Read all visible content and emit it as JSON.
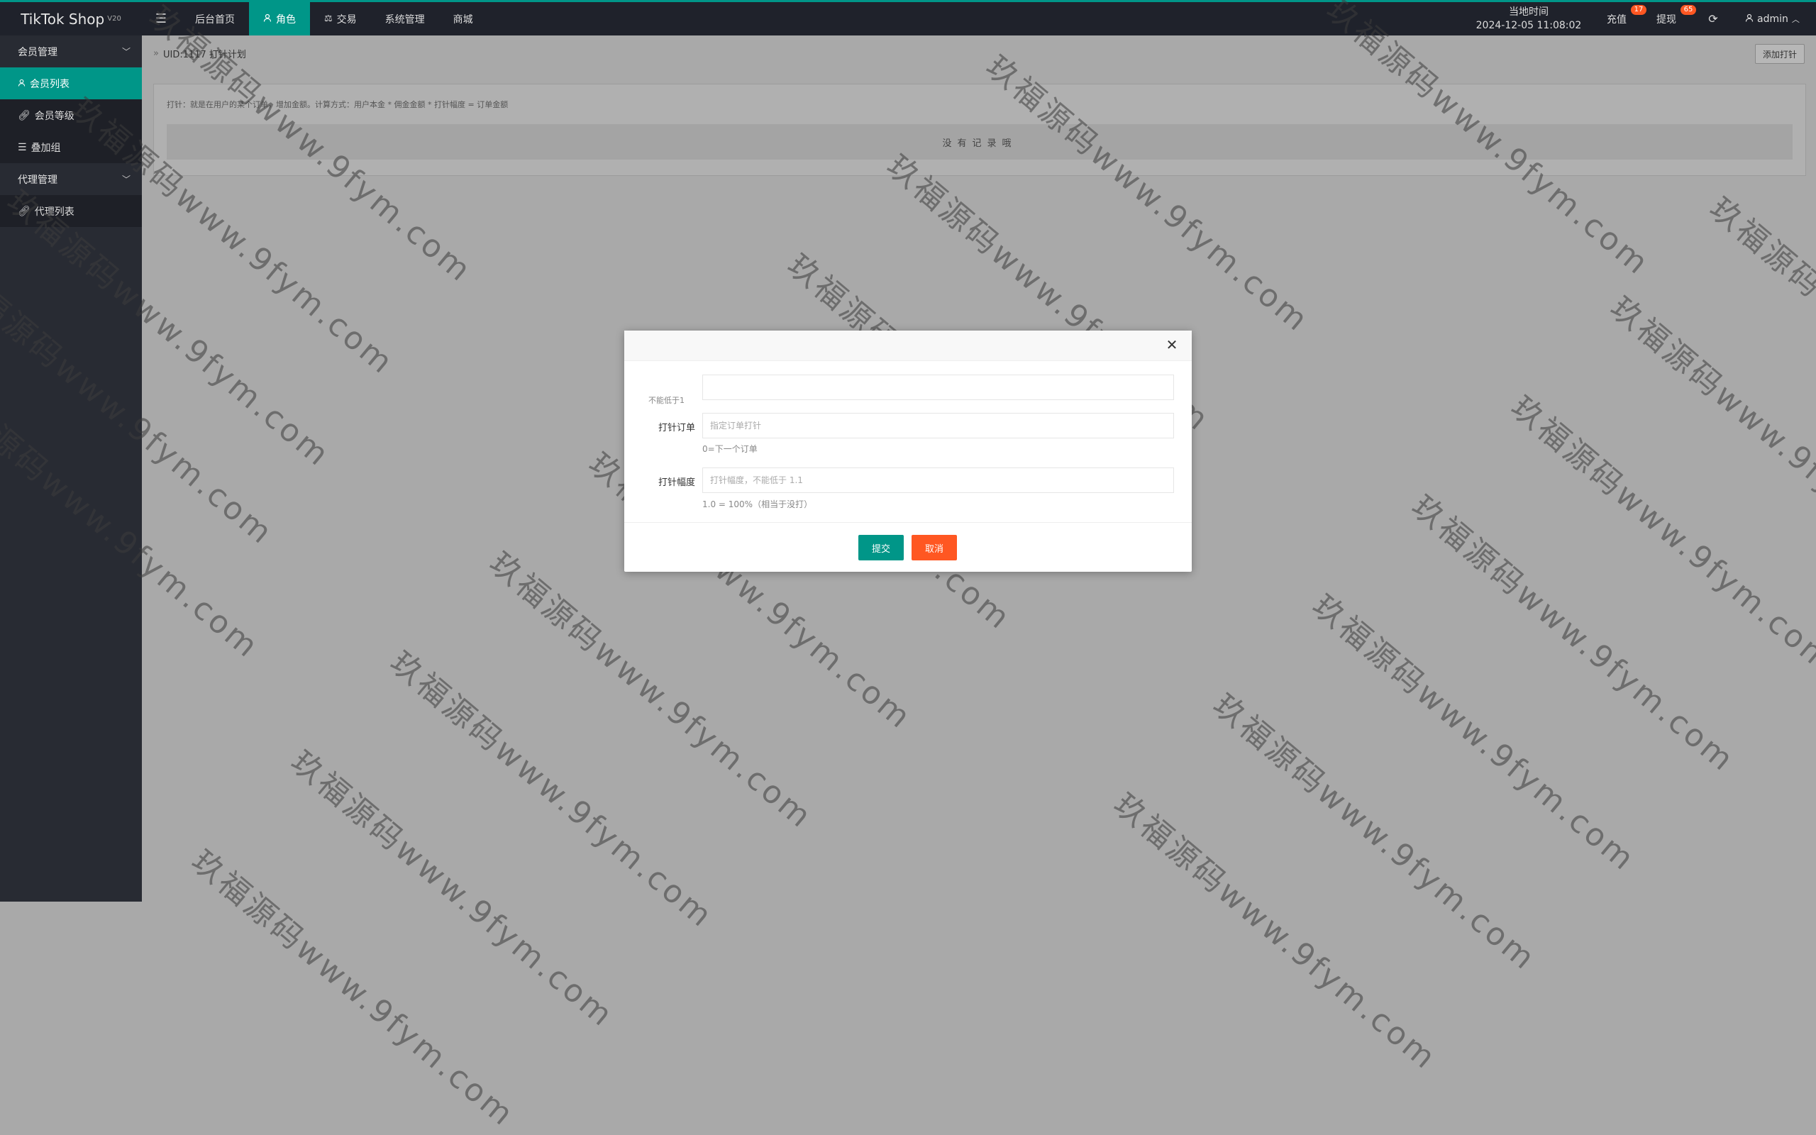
{
  "header": {
    "logo_text": "TikTok Shop",
    "logo_version": "V20",
    "menu_icon": "hamburger-icon",
    "nav": [
      {
        "label": "后台首页",
        "icon": ""
      },
      {
        "label": "角色",
        "icon": "user-icon"
      },
      {
        "label": "交易",
        "icon": "balance-icon"
      },
      {
        "label": "系统管理",
        "icon": ""
      },
      {
        "label": "商城",
        "icon": ""
      }
    ],
    "time_label": "当地时间",
    "time_value": "2024-12-05 11:08:02",
    "recharge_label": "充值",
    "recharge_badge": "17",
    "withdraw_label": "提现",
    "withdraw_badge": "65",
    "user_name": "admin"
  },
  "sidebar": {
    "groups": [
      {
        "label": "会员管理",
        "items": [
          {
            "label": "会员列表",
            "icon": "user-icon"
          },
          {
            "label": "会员等级",
            "icon": "link-icon"
          },
          {
            "label": "叠加组",
            "icon": "list-icon"
          }
        ]
      },
      {
        "label": "代理管理",
        "items": [
          {
            "label": "代理列表",
            "icon": "link-icon"
          }
        ]
      }
    ]
  },
  "main": {
    "breadcrumb": "UID:1117 打针计划",
    "add_button": "添加打针",
    "tip": "打针：就是在用户的某个订单，增加金额。计算方式：用户本金 * 佣金金额 * 打针幅度 = 订单金额",
    "empty_text": "没有记录哦"
  },
  "modal": {
    "field1_hint": "不能低于1",
    "order_label": "打针订单",
    "order_placeholder": "指定订单打针",
    "order_hint": "0=下一个订单",
    "range_label": "打针幅度",
    "range_placeholder": "打针幅度，不能低于 1.1",
    "range_hint": "1.0 = 100%（相当于没打）",
    "submit_label": "提交",
    "cancel_label": "取消"
  },
  "watermark": "玖福源码www.9fym.com",
  "colors": {
    "accent": "#009688",
    "danger": "#ff5722",
    "topbar": "#1f222b",
    "sidebar": "#282b33"
  }
}
